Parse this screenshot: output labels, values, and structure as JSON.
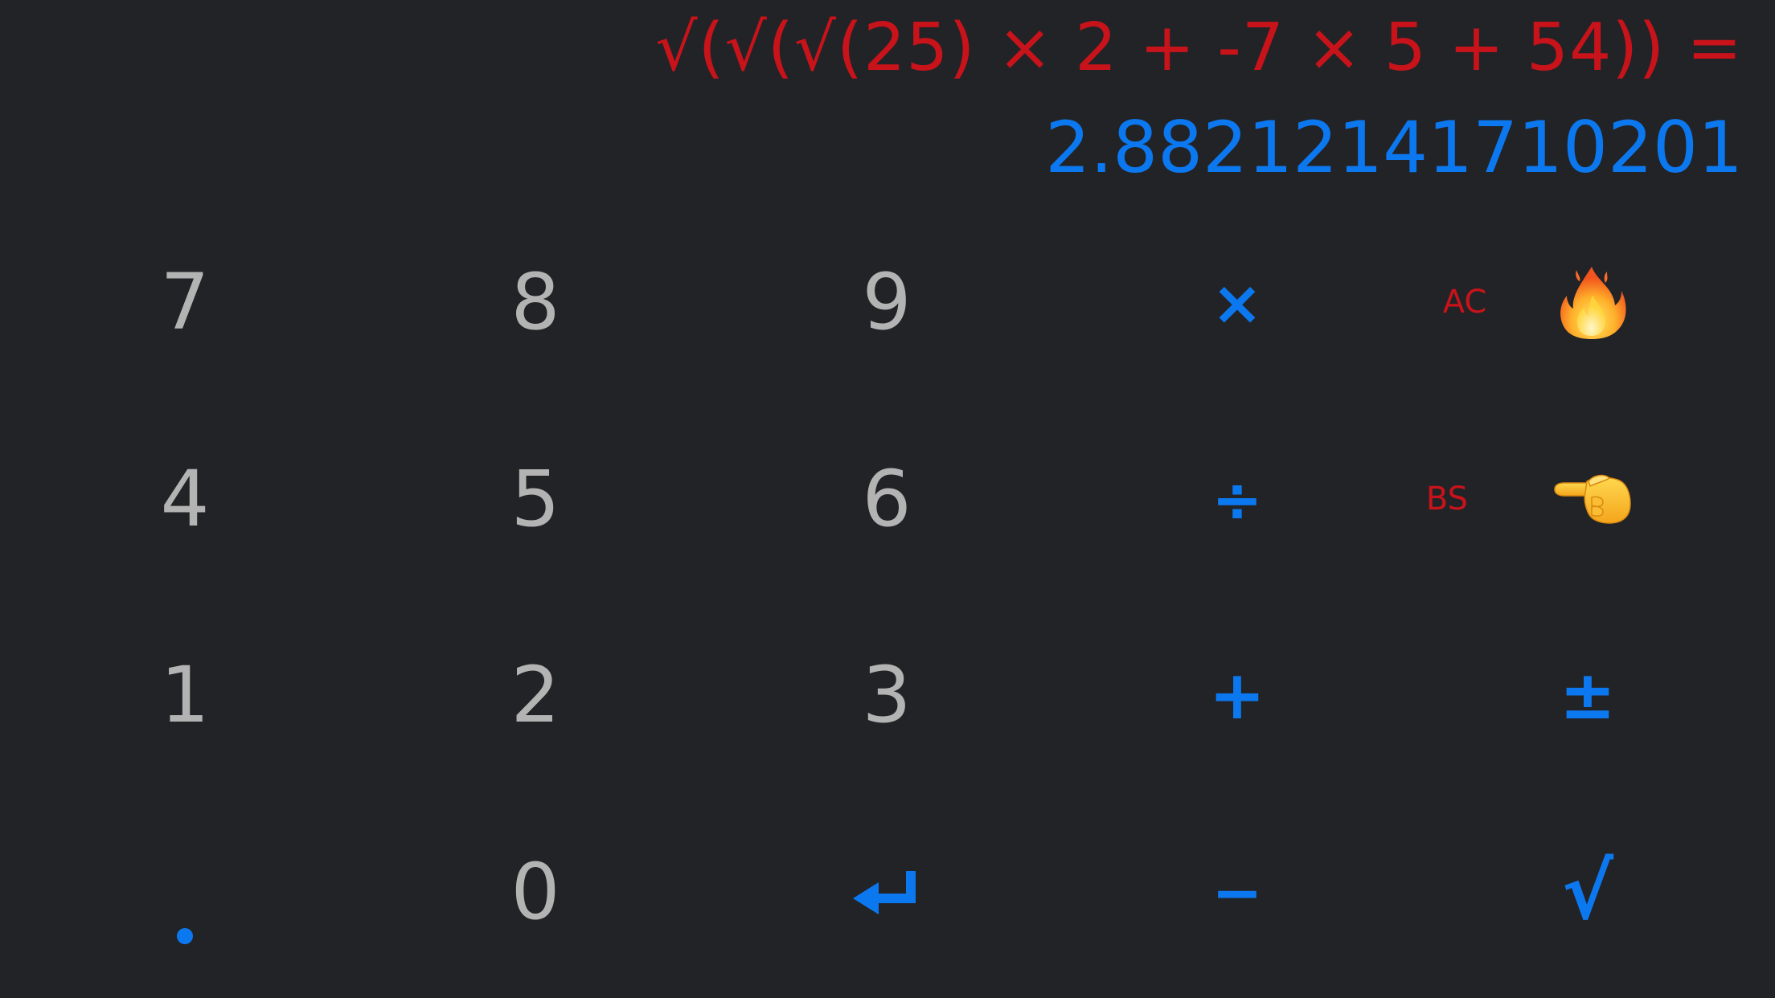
{
  "display": {
    "expression": "√(√(√(25) × 2 + -7 × 5 + 54)) =",
    "result": "2.88212141710201"
  },
  "keys": {
    "seven": "7",
    "eight": "8",
    "nine": "9",
    "four": "4",
    "five": "5",
    "six": "6",
    "one": "1",
    "two": "2",
    "three": "3",
    "zero": "0",
    "multiply": "×",
    "divide": "÷",
    "plus": "+",
    "minus": "−",
    "plus_minus": "±",
    "sqrt": "√",
    "all_clear": "AC",
    "backspace": "BS"
  },
  "icons": {
    "fire": "fire-icon",
    "pointing_hand": "backhand-index-pointing-left-icon",
    "enter": "return-arrow-icon",
    "decimal": "decimal-point"
  },
  "colors": {
    "background": "#222326",
    "digit": "#b3b3b3",
    "operator": "#0c78f0",
    "control": "#c8131b",
    "expression": "#c8131b",
    "result": "#0c78f0"
  }
}
